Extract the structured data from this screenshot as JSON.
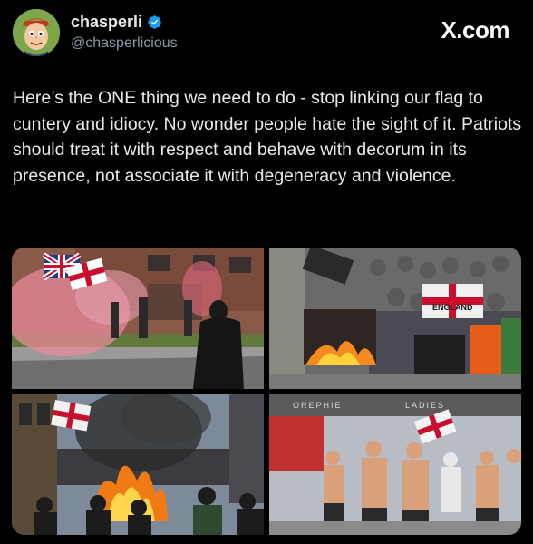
{
  "post": {
    "author": {
      "display_name": "chasperli",
      "handle": "@chasperlicious",
      "verified": true,
      "avatar_icon": "cartoon-face-avatar"
    },
    "brand": "X.com",
    "text": "Here’s the ONE thing we need to do - stop linking our flag to cuntery and idiocy. No wonder people hate the sight of it. Patriots should treat it with respect and behave with decorum in its presence, not associate it with degeneracy and violence."
  },
  "media": {
    "photos": [
      {
        "name": "photo-street-flare"
      },
      {
        "name": "photo-crowd-fire-bins",
        "sign_text": "ENGLAND"
      },
      {
        "name": "photo-burning-car"
      },
      {
        "name": "photo-shirtless-crowd",
        "sign_text": "LADIES"
      }
    ]
  },
  "colors": {
    "background": "#000000",
    "text": "#e7e9ea",
    "muted": "#8b98a5",
    "verified": "#1d9bf0"
  }
}
